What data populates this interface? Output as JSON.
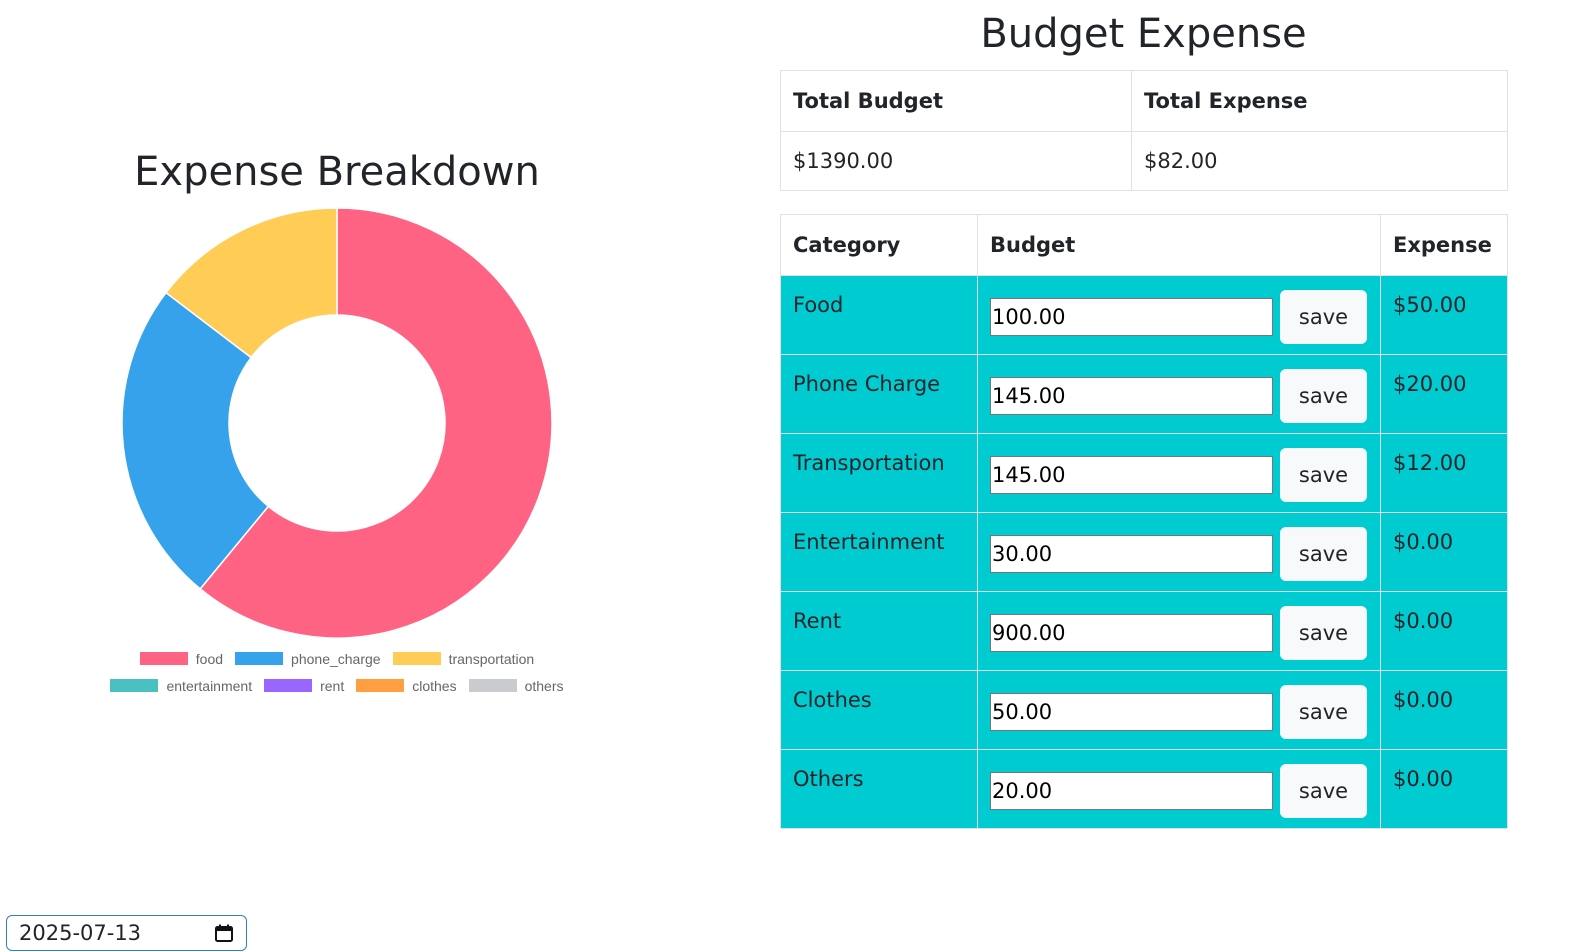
{
  "budget_panel": {
    "title": "Budget Expense",
    "totals_table": {
      "headers": [
        "Total Budget",
        "Total Expense"
      ],
      "values": [
        "$1390.00",
        "$82.00"
      ]
    },
    "category_table": {
      "headers": [
        "Category",
        "Budget",
        "Expense"
      ],
      "save_label": "save",
      "rows": [
        {
          "category": "Food",
          "budget": "100.00",
          "expense": "$50.00"
        },
        {
          "category": "Phone Charge",
          "budget": "145.00",
          "expense": "$20.00"
        },
        {
          "category": "Transportation",
          "budget": "145.00",
          "expense": "$12.00"
        },
        {
          "category": "Entertainment",
          "budget": "30.00",
          "expense": "$0.00"
        },
        {
          "category": "Rent",
          "budget": "900.00",
          "expense": "$0.00"
        },
        {
          "category": "Clothes",
          "budget": "50.00",
          "expense": "$0.00"
        },
        {
          "category": "Others",
          "budget": "20.00",
          "expense": "$0.00"
        }
      ],
      "row_color": "#00cbd1"
    }
  },
  "date_picker": {
    "value": "2025-07-13",
    "icon": "calendar-icon",
    "border_color": "#2f80c7"
  },
  "chart_data": {
    "type": "pie",
    "subtype": "doughnut",
    "title": "Expense Breakdown",
    "categories": [
      "food",
      "phone_charge",
      "transportation",
      "entertainment",
      "rent",
      "clothes",
      "others"
    ],
    "values": [
      50,
      20,
      12,
      0,
      0,
      0,
      0
    ],
    "colors": [
      "#ff6384",
      "#36a2eb",
      "#ffcd56",
      "#4bc0c0",
      "#9966ff",
      "#ff9f40",
      "#c9cbcf"
    ],
    "legend_position": "bottom"
  }
}
